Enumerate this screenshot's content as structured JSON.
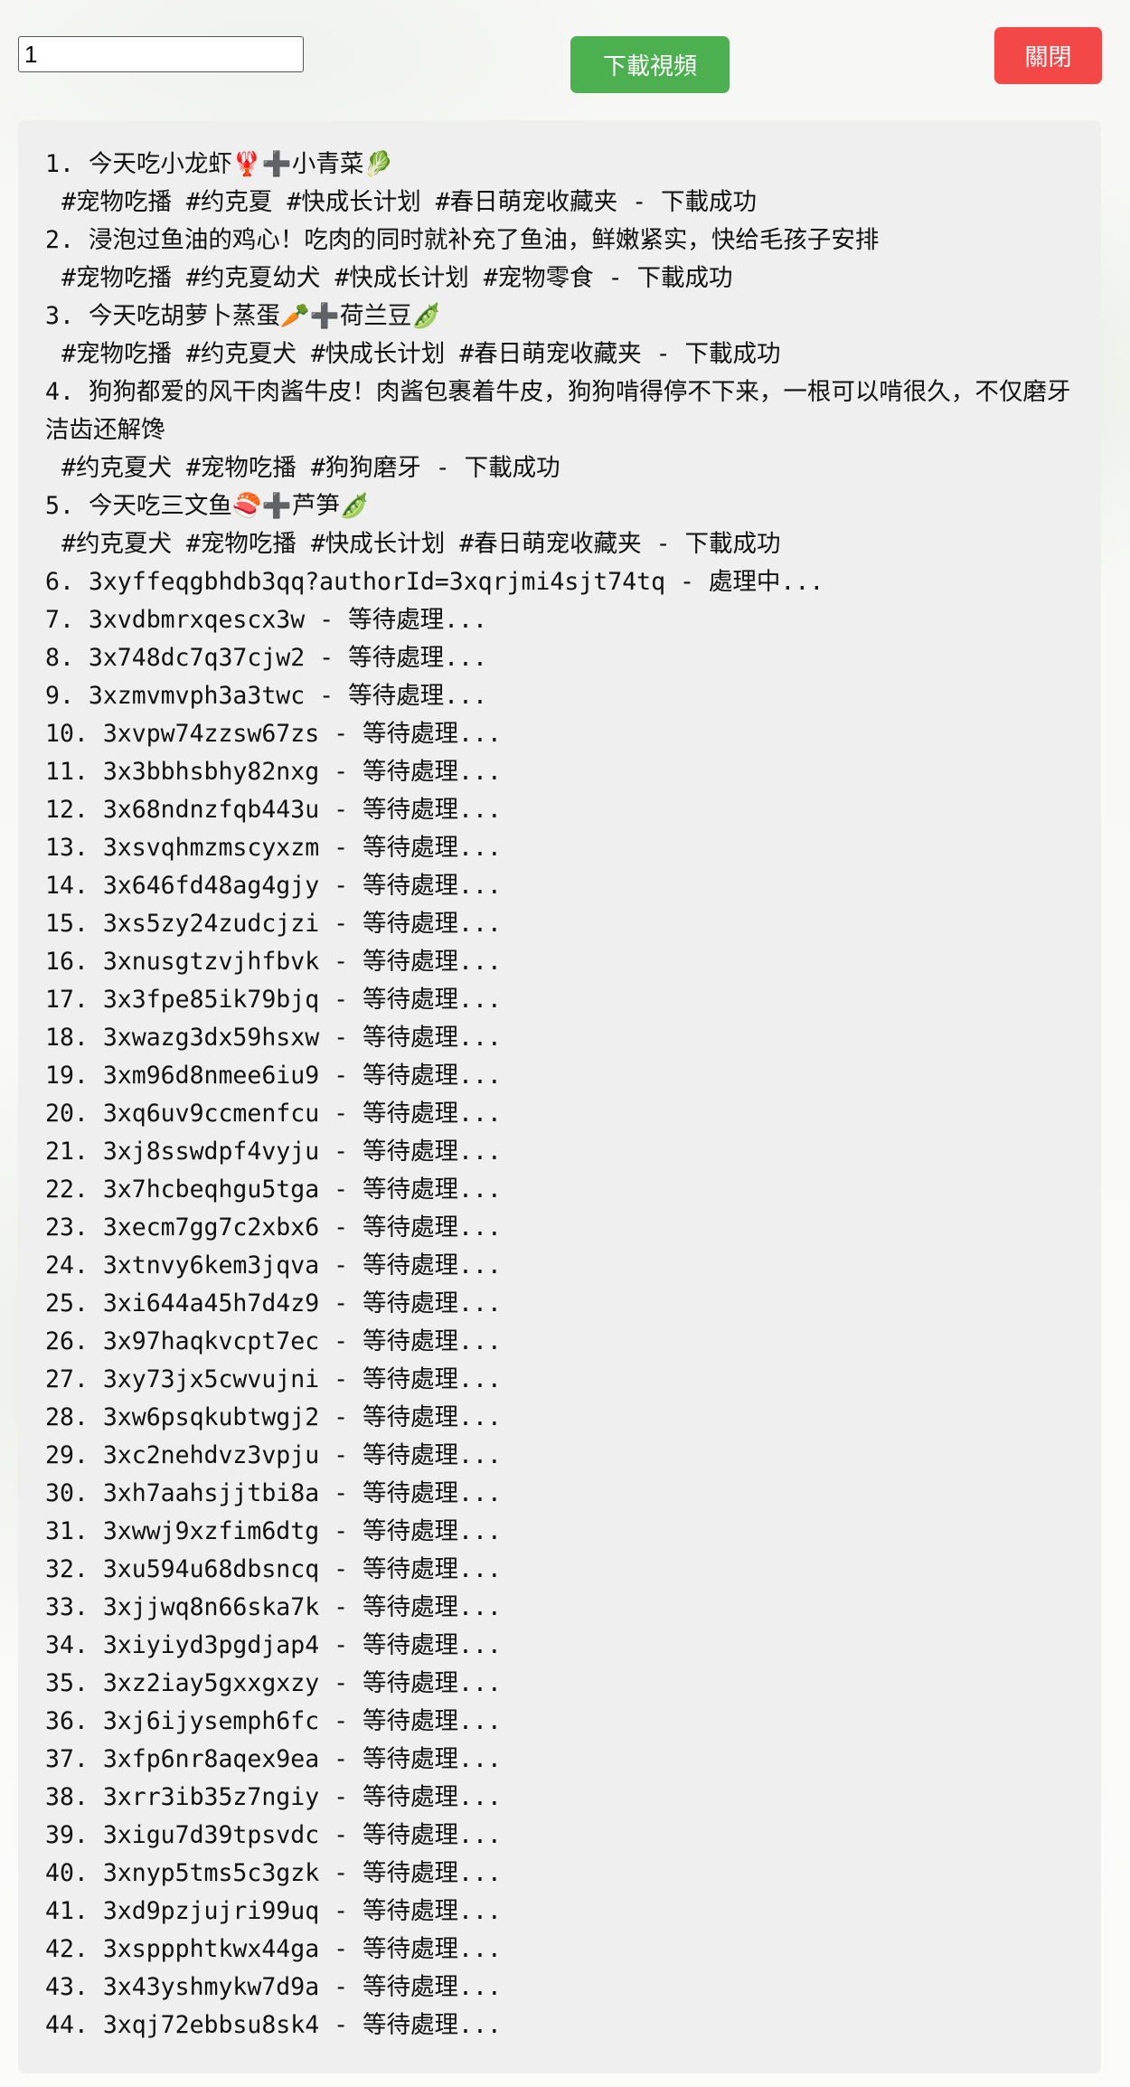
{
  "toolbar": {
    "count_value": "1",
    "download_label": "下載視頻",
    "close_label": "關閉"
  },
  "log": {
    "items": [
      {
        "num": "1.",
        "title": "今天吃小龙虾🦞➕小青菜🥬",
        "tags": "#宠物吃播 #约克夏 #快成长计划 #春日萌宠收藏夹 - 下載成功"
      },
      {
        "num": "2.",
        "title": "浸泡过鱼油的鸡心！吃肉的同时就补充了鱼油，鲜嫩紧实，快给毛孩子安排",
        "tags": "#宠物吃播 #约克夏幼犬 #快成长计划 #宠物零食 - 下載成功"
      },
      {
        "num": "3.",
        "title": "今天吃胡萝卜蒸蛋🥕➕荷兰豆🫛",
        "tags": "#宠物吃播 #约克夏犬 #快成长计划 #春日萌宠收藏夹 - 下載成功"
      },
      {
        "num": "4.",
        "title": "狗狗都爱的风干肉酱牛皮！肉酱包裹着牛皮，狗狗啃得停不下来，一根可以啃很久，不仅磨牙洁齿还解馋",
        "tags": "#约克夏犬 #宠物吃播 #狗狗磨牙 - 下載成功"
      },
      {
        "num": "5.",
        "title": "今天吃三文鱼🍣➕芦笋🫛",
        "tags": "#约克夏犬 #宠物吃播 #快成长计划 #春日萌宠收藏夹 - 下載成功"
      },
      {
        "num": "6.",
        "title": "3xyffeqgbhdb3qq?authorId=3xqrjmi4sjt74tq - 處理中...",
        "tags": ""
      },
      {
        "num": "7.",
        "title": "3xvdbmrxqescx3w - 等待處理...",
        "tags": ""
      },
      {
        "num": "8.",
        "title": "3x748dc7q37cjw2 - 等待處理...",
        "tags": ""
      },
      {
        "num": "9.",
        "title": "3xzmvmvph3a3twc - 等待處理...",
        "tags": ""
      },
      {
        "num": "10.",
        "title": "3xvpw74zzsw67zs - 等待處理...",
        "tags": ""
      },
      {
        "num": "11.",
        "title": "3x3bbhsbhy82nxg - 等待處理...",
        "tags": ""
      },
      {
        "num": "12.",
        "title": "3x68ndnzfqb443u - 等待處理...",
        "tags": ""
      },
      {
        "num": "13.",
        "title": "3xsvqhmzmscyxzm - 等待處理...",
        "tags": ""
      },
      {
        "num": "14.",
        "title": "3x646fd48ag4gjy - 等待處理...",
        "tags": ""
      },
      {
        "num": "15.",
        "title": "3xs5zy24zudcjzi - 等待處理...",
        "tags": ""
      },
      {
        "num": "16.",
        "title": "3xnusgtzvjhfbvk - 等待處理...",
        "tags": ""
      },
      {
        "num": "17.",
        "title": "3x3fpe85ik79bjq - 等待處理...",
        "tags": ""
      },
      {
        "num": "18.",
        "title": "3xwazg3dx59hsxw - 等待處理...",
        "tags": ""
      },
      {
        "num": "19.",
        "title": "3xm96d8nmee6iu9 - 等待處理...",
        "tags": ""
      },
      {
        "num": "20.",
        "title": "3xq6uv9ccmenfcu - 等待處理...",
        "tags": ""
      },
      {
        "num": "21.",
        "title": "3xj8sswdpf4vyju - 等待處理...",
        "tags": ""
      },
      {
        "num": "22.",
        "title": "3x7hcbeqhgu5tga - 等待處理...",
        "tags": ""
      },
      {
        "num": "23.",
        "title": "3xecm7gg7c2xbx6 - 等待處理...",
        "tags": ""
      },
      {
        "num": "24.",
        "title": "3xtnvy6kem3jqva - 等待處理...",
        "tags": ""
      },
      {
        "num": "25.",
        "title": "3xi644a45h7d4z9 - 等待處理...",
        "tags": ""
      },
      {
        "num": "26.",
        "title": "3x97haqkvcpt7ec - 等待處理...",
        "tags": ""
      },
      {
        "num": "27.",
        "title": "3xy73jx5cwvujni - 等待處理...",
        "tags": ""
      },
      {
        "num": "28.",
        "title": "3xw6psqkubtwgj2 - 等待處理...",
        "tags": ""
      },
      {
        "num": "29.",
        "title": "3xc2nehdvz3vpju - 等待處理...",
        "tags": ""
      },
      {
        "num": "30.",
        "title": "3xh7aahsjjtbi8a - 等待處理...",
        "tags": ""
      },
      {
        "num": "31.",
        "title": "3xwwj9xzfim6dtg - 等待處理...",
        "tags": ""
      },
      {
        "num": "32.",
        "title": "3xu594u68dbsncq - 等待處理...",
        "tags": ""
      },
      {
        "num": "33.",
        "title": "3xjjwq8n66ska7k - 等待處理...",
        "tags": ""
      },
      {
        "num": "34.",
        "title": "3xiyiyd3pgdjap4 - 等待處理...",
        "tags": ""
      },
      {
        "num": "35.",
        "title": "3xz2iay5gxxgxzy - 等待處理...",
        "tags": ""
      },
      {
        "num": "36.",
        "title": "3xj6ijysemph6fc - 等待處理...",
        "tags": ""
      },
      {
        "num": "37.",
        "title": "3xfp6nr8aqex9ea - 等待處理...",
        "tags": ""
      },
      {
        "num": "38.",
        "title": "3xrr3ib35z7ngiy - 等待處理...",
        "tags": ""
      },
      {
        "num": "39.",
        "title": "3xigu7d39tpsvdc - 等待處理...",
        "tags": ""
      },
      {
        "num": "40.",
        "title": "3xnyp5tms5c3gzk - 等待處理...",
        "tags": ""
      },
      {
        "num": "41.",
        "title": "3xd9pzjujri99uq - 等待處理...",
        "tags": ""
      },
      {
        "num": "42.",
        "title": "3xsppphtkwx44ga - 等待處理...",
        "tags": ""
      },
      {
        "num": "43.",
        "title": "3x43yshmykw7d9a - 等待處理...",
        "tags": ""
      },
      {
        "num": "44.",
        "title": "3xqj72ebbsu8sk4 - 等待處理...",
        "tags": ""
      }
    ]
  }
}
